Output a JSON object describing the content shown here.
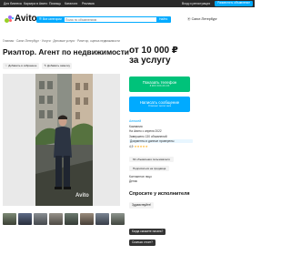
{
  "colors": {
    "accent": "#00aaff",
    "green": "#00c27a",
    "topbar": "#2a2a2a",
    "rating": "#ffb021"
  },
  "topbar": {
    "items": [
      "Для бизнеса",
      "Карьера в Авито",
      "Помощь",
      "Каталоги",
      "Реклама"
    ],
    "right_link": "Вход и регистрация",
    "post_button": "Разместить объявление"
  },
  "header": {
    "logo": "Avito",
    "all_categories": "Все категории",
    "search_placeholder": "Поиск по объявлениям",
    "search_button": "Найти",
    "location": "Санкт-Петербург"
  },
  "breadcrumb": "Главная · Санкт-Петербург · Услуги · Деловые услуги · Риэлтор, оценка недвижимости",
  "listing": {
    "title": "Риэлтор. Агент по недвижимости",
    "favorite": "Добавить в избранное",
    "compare": "Добавить заметку",
    "watermark": "Avito"
  },
  "sidebar": {
    "price_line1": "от 10 000 ₽",
    "price_line2": "за услугу",
    "phone_button": "Показать телефон",
    "phone_sub": "8 9XX XXX-XX-XX",
    "message_button": "Написать сообщение",
    "message_sub": "Отвечает около часа",
    "seller_name": "Алексей",
    "seller_type": "Компания",
    "seller_since": "На Авито с апреля 2022",
    "seller_done": "Завершено 130 объявлений",
    "seller_docs": "Документы и данные проверены",
    "rating_value": "4,9",
    "all_listings": "63 объявления пользователя",
    "subscribe": "Подписаться на продавца",
    "contact_person": "Контактное лицо",
    "contact_name": "Денис",
    "ask_header": "Спросите у исполнителя",
    "ask_hello": "Здравствуйте!",
    "ask_q1": "Когда сможете начать?",
    "ask_q2": "Сколько стоит?"
  }
}
